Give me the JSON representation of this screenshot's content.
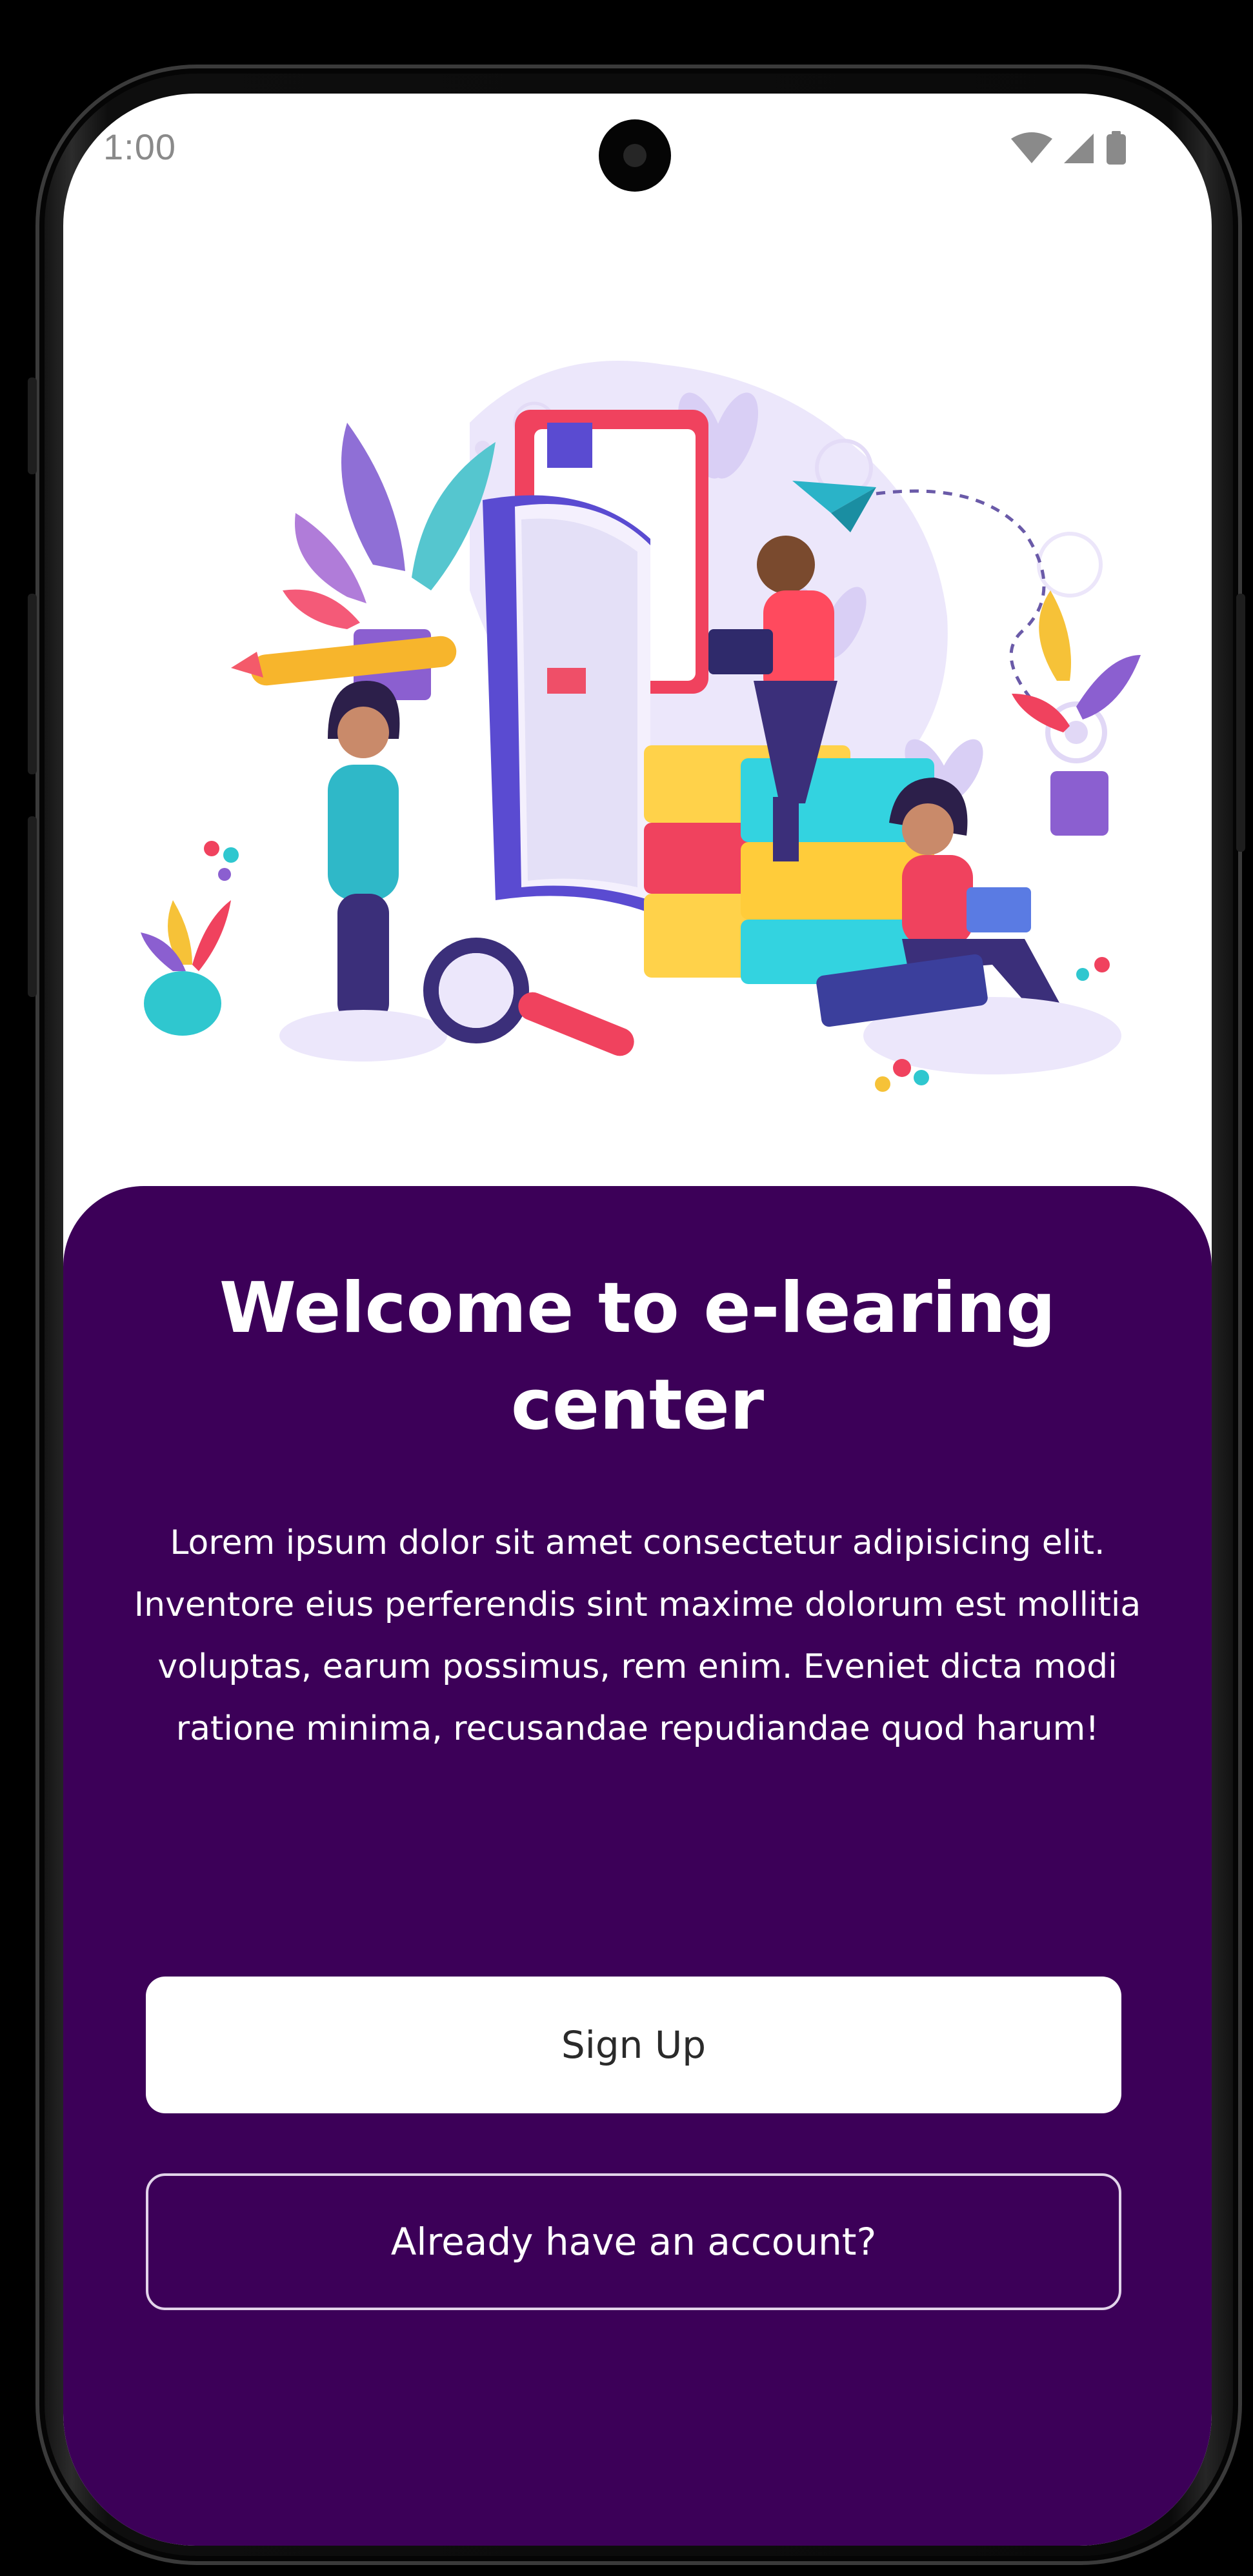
{
  "status_bar": {
    "time": "1:00",
    "icons": [
      "wifi-icon",
      "cellular-signal-icon",
      "battery-icon"
    ]
  },
  "illustration": {
    "name": "e-learning-books-illustration"
  },
  "welcome": {
    "title": "Welcome to e-learing center",
    "body": "Lorem ipsum dolor sit amet consectetur adipisicing elit. Inventore eius perferendis sint maxime dolorum est mollitia voluptas, earum possimus, rem enim. Eveniet dicta modi ratione minima, recusandae repudiandae quod harum!"
  },
  "actions": {
    "signup_label": "Sign Up",
    "login_label": "Already have an account?"
  },
  "colors": {
    "panel_background": "#3c0058",
    "signup_button_background": "#ffffff",
    "login_button_border": "#e2d4ea",
    "screen_background": "#ffffff"
  }
}
